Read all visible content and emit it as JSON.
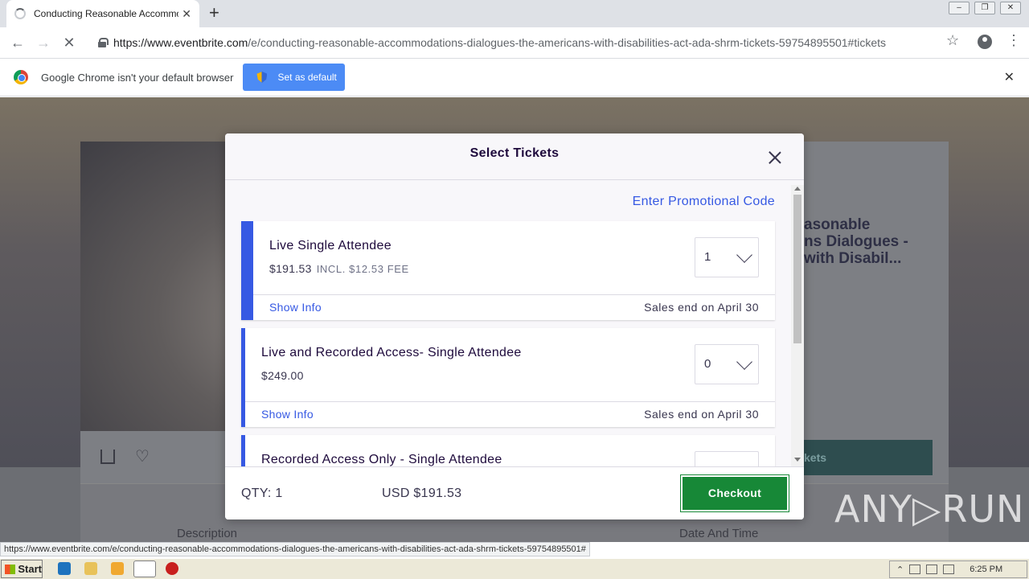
{
  "browser": {
    "tab_title": "Conducting Reasonable Accommodati",
    "url_host": "https://www.eventbrite.com",
    "url_path": "/e/conducting-reasonable-accommodations-dialogues-the-americans-with-disabilities-act-ada-shrm-tickets-59754895501#tickets",
    "infobar_text": "Google Chrome isn't your default browser",
    "set_default_label": "Set as default",
    "status_url": "https://www.eventbrite.com/e/conducting-reasonable-accommodations-dialogues-the-americans-with-disabilities-act-ada-shrm-tickets-59754895501#"
  },
  "background_page": {
    "title_line1": "asonable",
    "title_line2": "ns Dialogues -",
    "title_line3": "with Disabil...",
    "tickets_button": "kets",
    "description_label": "Description",
    "date_label": "Date And Time"
  },
  "modal": {
    "title": "Select Tickets",
    "promo_link": "Enter Promotional Code",
    "tickets": [
      {
        "name": "Live Single Attendee",
        "price": "$191.53",
        "fee": "INCL. $12.53 FEE",
        "qty": "1",
        "show_info": "Show Info",
        "sales_end": "Sales end on April 30"
      },
      {
        "name": "Live and Recorded Access- Single Attendee",
        "price": "$249.00",
        "qty": "0",
        "show_info": "Show Info",
        "sales_end": "Sales end on April 30"
      },
      {
        "name": "Recorded Access Only - Single Attendee"
      }
    ],
    "footer": {
      "qty": "QTY: 1",
      "total": "USD $191.53",
      "checkout_label": "Checkout"
    }
  },
  "watermark": "ANY▷RUN",
  "taskbar": {
    "start_label": "Start",
    "clock": "6:25 PM"
  },
  "colors": {
    "accent": "#3659e3",
    "checkout": "#178837"
  }
}
